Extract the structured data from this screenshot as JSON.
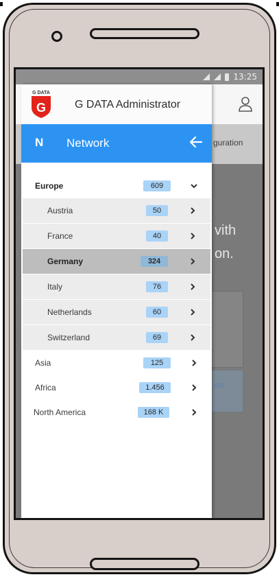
{
  "status_bar": {
    "time": "13:25"
  },
  "background_app": {
    "tab_fragment": "guration",
    "big_line1": "vith",
    "big_line2": "on.",
    "link_fragment": "nts"
  },
  "drawer": {
    "app_title": "G DATA Administrator",
    "logo_text": "G DATA",
    "bar_letter": "N",
    "bar_title": "Network"
  },
  "tree": {
    "europe": {
      "label": "Europe",
      "count": "609"
    },
    "countries": [
      {
        "label": "Austria",
        "count": "50"
      },
      {
        "label": "France",
        "count": "40"
      },
      {
        "label": "Germany",
        "count": "324"
      },
      {
        "label": "Italy",
        "count": "76"
      },
      {
        "label": "Netherlands",
        "count": "60"
      },
      {
        "label": "Switzerland",
        "count": "69"
      }
    ],
    "asia": {
      "label": "Asia",
      "count": "125"
    },
    "africa": {
      "label": "Africa",
      "count": "1.456"
    },
    "north_america": {
      "label": "North America",
      "count": "168 K"
    }
  },
  "colors": {
    "accent": "#2c93f2",
    "badge": "#a9d3f7",
    "logo_red": "#e2231a"
  }
}
